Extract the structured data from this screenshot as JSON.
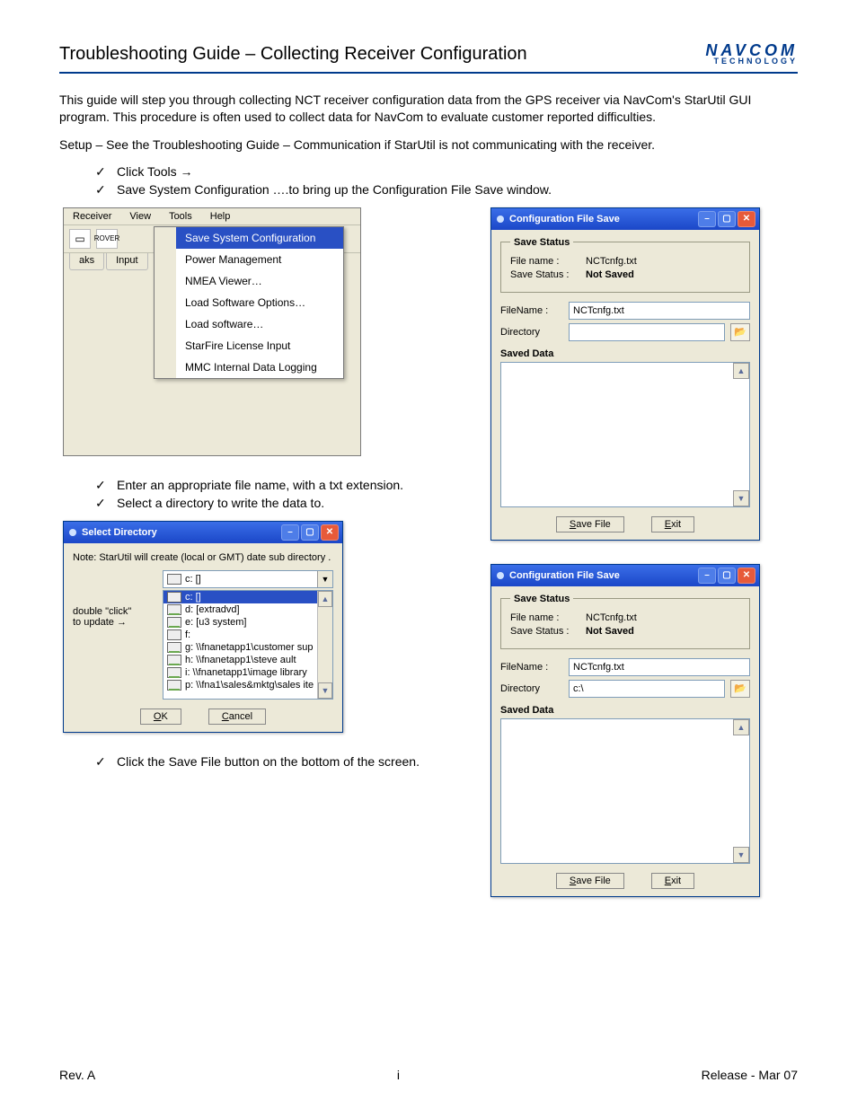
{
  "header": {
    "title": "Troubleshooting Guide – Collecting Receiver Configuration"
  },
  "logo": {
    "top": "NAVCOM",
    "bottom": "TECHNOLOGY"
  },
  "intro": "This guide will step you through collecting NCT receiver configuration data from the GPS receiver via NavCom's StarUtil GUI program. This procedure is often used to collect data for NavCom to evaluate customer reported difficulties.",
  "setup_note": "Setup – See the Troubleshooting Guide – Communication if StarUtil is not communicating with the receiver.",
  "steps_top": [
    "Click  Tools  →",
    "Save System Configuration ….to bring up the Configuration File Save window."
  ],
  "menubar": {
    "items": [
      "Receiver",
      "View",
      "Tools",
      "Help"
    ]
  },
  "toolbar": {
    "rover_label": "ROVER"
  },
  "tabstrip": {
    "items": [
      "aks",
      "Input"
    ]
  },
  "tools_menu": {
    "items": [
      "Save System Configuration",
      "Power Management",
      "NMEA Viewer…",
      "Load Software Options…",
      "Load software…",
      "StarFire License Input",
      "MMC Internal Data Logging"
    ],
    "highlighted_index": 0
  },
  "steps_mid": [
    "Enter an appropriate file name, with a txt extension.",
    "Select a directory to write the data to."
  ],
  "select_dir": {
    "title": "Select Directory",
    "note": "Note: StarUtil will create (local or GMT) date sub directory .",
    "hint_lines": [
      "double \"click\"",
      "to update"
    ],
    "hint_arrow": "→",
    "combo_value": "c: []",
    "drives": [
      {
        "label": "c: []",
        "type": "local",
        "selected": true
      },
      {
        "label": "d: [extradvd]",
        "type": "net",
        "selected": false
      },
      {
        "label": "e: [u3 system]",
        "type": "net",
        "selected": false
      },
      {
        "label": "f:",
        "type": "local",
        "selected": false
      },
      {
        "label": "g: \\\\fnanetapp1\\customer sup",
        "type": "net",
        "selected": false
      },
      {
        "label": "h: \\\\fnanetapp1\\steve ault",
        "type": "net",
        "selected": false
      },
      {
        "label": "i: \\\\fnanetapp1\\image library",
        "type": "net",
        "selected": false
      },
      {
        "label": "p: \\\\fna1\\sales&mktg\\sales ite",
        "type": "net",
        "selected": false
      }
    ],
    "ok": "OK",
    "cancel": "Cancel"
  },
  "steps_bot": [
    "Click the Save File button on the bottom of the screen."
  ],
  "cfg_save": {
    "title": "Configuration File Save",
    "group_status": "Save Status",
    "filename_label": "File name :",
    "savestatus_label": "Save Status :",
    "filename_value": "NCTcnfg.txt",
    "savestatus_value": "Not Saved",
    "filename_in_label": "FileName :",
    "directory_label": "Directory",
    "filename_input": "NCTcnfg.txt",
    "directory_input_a": "",
    "directory_input_b": "c:\\",
    "saved_data": "Saved Data",
    "save_btn": "Save File",
    "exit_btn": "Exit"
  },
  "footer": {
    "left": "Rev. A",
    "center": "i",
    "right": "Release - Mar 07"
  }
}
